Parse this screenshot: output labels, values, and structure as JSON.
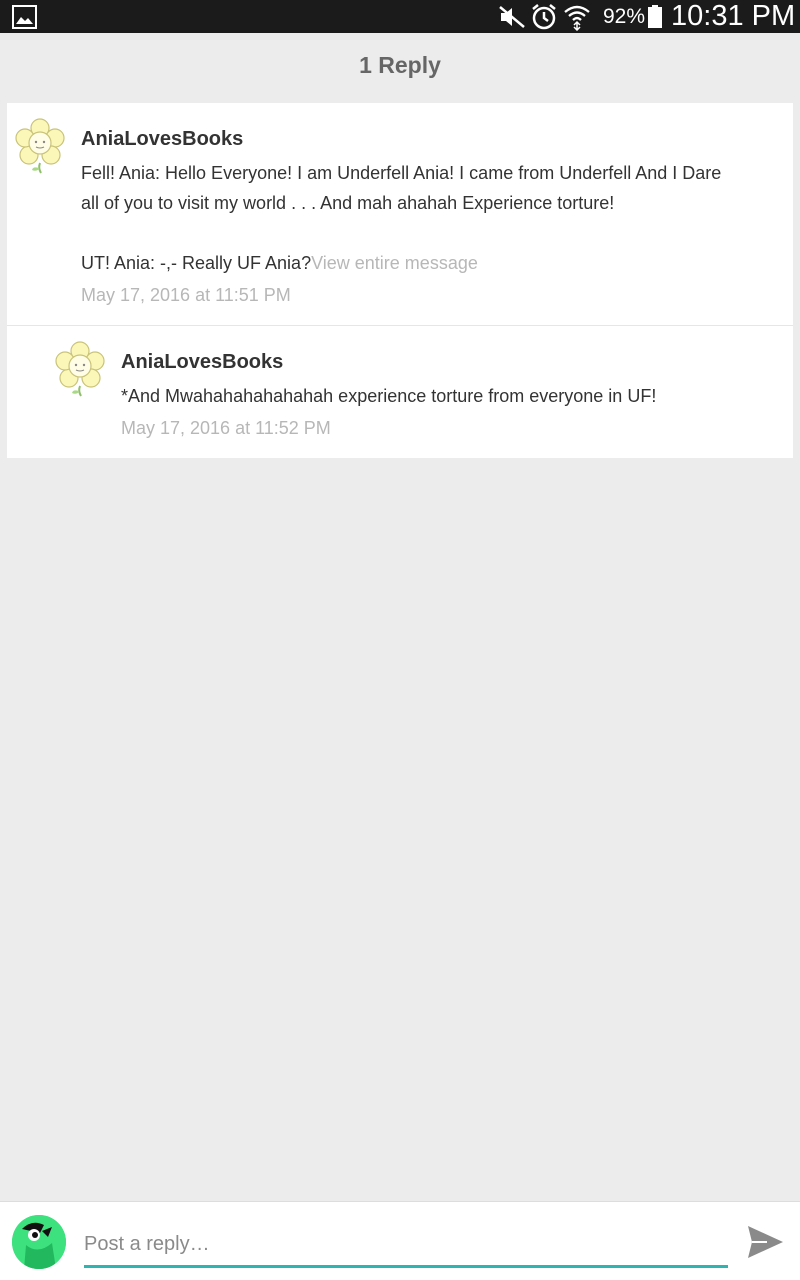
{
  "status_bar": {
    "battery_pct": "92%",
    "time": "10:31 PM",
    "icons": [
      "gallery-icon",
      "mute-icon",
      "alarm-icon",
      "wifi-icon",
      "battery-icon"
    ]
  },
  "header": {
    "title": "1 Reply"
  },
  "comments": [
    {
      "author": "AniaLovesBooks",
      "line1": "Fell! Ania: Hello Everyone! I am Underfell Ania! I came from Underfell And I Dare",
      "line2": "all of you to visit my world . . . And mah ahahah Experience torture!",
      "line3": "UT! Ania: -,- Really UF Ania?",
      "view_more": "View entire message",
      "timestamp": "May 17, 2016 at 11:51 PM"
    },
    {
      "author": "AniaLovesBooks",
      "text": "*And Mwahahahahahahah experience torture from everyone in UF!",
      "timestamp": "May 17, 2016 at 11:52 PM"
    }
  ],
  "reply_bar": {
    "placeholder": "Post a reply…"
  },
  "colors": {
    "accent": "#2fb5b1",
    "background": "#ececec",
    "muted_text": "#b7b7b7"
  }
}
